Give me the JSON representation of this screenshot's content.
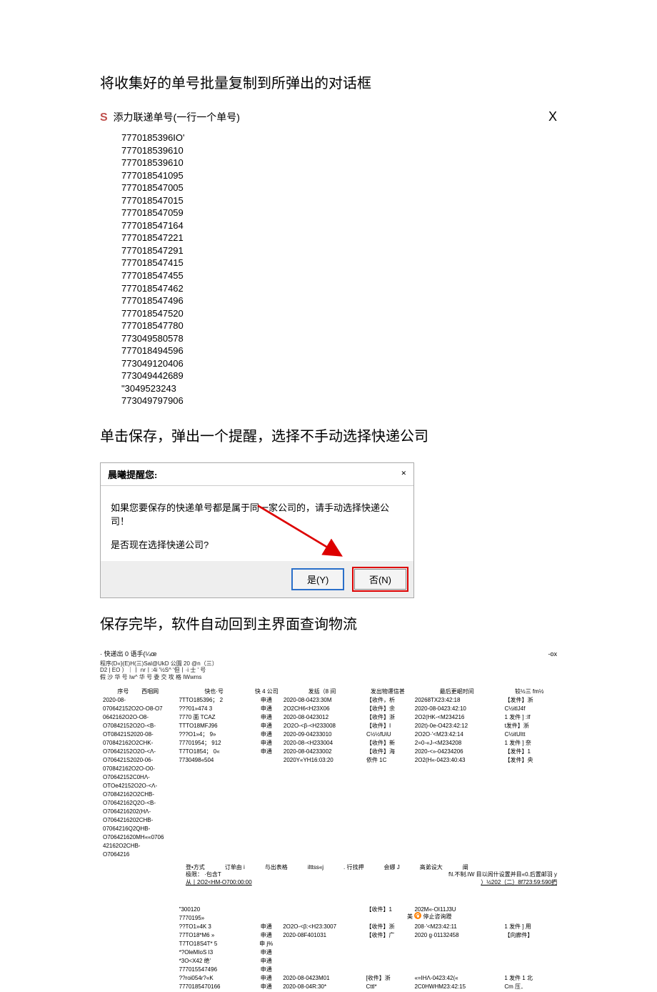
{
  "section1": {
    "heading": "将收集好的单号批量复制到所弹出的对话框",
    "dialog": {
      "icon": "S",
      "title": "添力联递单号(一行一个单号)",
      "close": "X"
    },
    "tracking_numbers": [
      "7770185396IO'",
      "777018539610",
      "777018539610",
      "777018541095",
      "777018547005",
      "777018547015",
      "777018547059",
      "777018547164",
      "777018547221",
      "777018547291",
      "777018547415",
      "777018547455",
      "777018547462",
      "777018547496",
      "777018547520",
      "777018547780",
      "773049580578",
      "777018494596",
      "773049120406",
      "773049442689",
      "\"3049523243",
      "773049797906"
    ]
  },
  "section2": {
    "heading": "单击保存，弹出一个提醒，选择不手动选择快递公司",
    "dialog": {
      "title": "晨曦提醒您:",
      "close": "×",
      "msg1": "如果您要保存的快递单号都是属于同一家公司的，请手动选择快递公司！",
      "msg2": "是否现在选择快递公司?",
      "btn_yes": "是(Y)",
      "btn_no": "否(N)"
    }
  },
  "section3": {
    "heading": "保存完毕，软件自动回到主界面查询物流",
    "window": {
      "title_left": "· 快递出 0 语手(¼œ",
      "title_right": "-ox",
      "menu_line1": "程序(D«}(E)H(三)Sal@UkD 公園 20 @n（三）",
      "menu_line2": "    D2 | EO ）｜丨 nr丨:4i '½S^ '但丨·i 士 ' 号",
      "menu_line3": "假 沙 华 号  Iw^ 华 号 委 交 攻 格  IWwms",
      "headers": {
        "seq": "序号",
        "trail": "西咽网",
        "trk": "快也·号",
        "comp": "快 4 公司",
        "send": "发括（8 间",
        "info": "发出物運信甚",
        "time": "最后更岷时间",
        "last": "较½三 fm½"
      },
      "col_seq": [
        "2020-08-",
        "070642152O2O-O8-O7",
        "0642162O2O-O8-",
        "O70842152O2O-<B-",
        "OT08421S2020-08-",
        "070842162O2CHK-",
        "O70642152O2O-<Λ-",
        "O706421S2020-06-",
        "070842162O2O-O0-",
        "O70642152C0HΛ-",
        "OTOe42152O2O-<Λ-",
        "O70842162O2CHB-",
        "O70642162Q2O-<B-",
        "O7064216202(HΛ-",
        "O7064216202CHB-",
        "07064216Q2QHB-",
        "O706421620MH««0706",
        "42162O2CHB-",
        "O7064216"
      ],
      "col_trk": [
        "7TTO185396；  2",
        "???01»474      3",
        "7770 面 TCAZ",
        "TTTO18MFJ96",
        "???O1»4；   9»",
        "77701954；  912",
        "T7TO1854；  0«",
        "7730498«504"
      ],
      "col_comp_many": "申通",
      "col_send": [
        "2020-08-0423:30M",
        "2O2CH6<H23X06",
        "2020-08-0423012",
        "2O2O-<β-<H233008",
        "2020-09-04233010",
        "2020-08-<H233004",
        "2020-08-04233002",
        "2020Y«YH16:03:20"
      ],
      "col_info": [
        "【收件，析",
        "【收件】余",
        "【收件】浙",
        "【收件】I",
        "C½½fUiU",
        "【收件】新",
        "【收件】海",
        "依件 1C"
      ],
      "col_time": [
        "20268TX23:42:18",
        "2020-08-0423:42:10",
        "2O2(HK-<M234216",
        "202t)-0e-O423:42:12",
        "2O2O·'<M23:42:14",
        "2=0-«J-<M234208",
        "2020-<»-04234206",
        "2O2(H«-0423:40:43"
      ],
      "col_last": [
        "【发件】浙",
        "C½itlJ4f",
        "1 发件 ] :If",
        "t发件】浙",
        "C½itUItt",
        "1 发件 ] 奈",
        "【发件】1",
        "【发件】央"
      ],
      "mid_row_labels": [
        "登•方式",
        "订单由 i",
        "与出表格",
        "ilttss«j",
        ". 行找押",
        "会娜 J",
        "高弟设大",
        "阐"
      ],
      "mid_row_sub1": "f\\l.不制.IW 目以闾什设置并目«0.后置邮羽 y",
      "mid_row_sub2": "）½202（二）8f723:59:590捫",
      "extreme_label": "极限：",
      "extreme_sub": "·包含T",
      "extreme_range": "从丨2O2<HM-O700:00:00",
      "bottom_trk": [
        "\"300120",
        "7770195»",
        "??TO1»4K       3",
        "77TO18*M6      »",
        "T7TO18S4T*    5",
        "*?OleMIoS      I3",
        "*3O<X42 绝'",
        "777015547496",
        "??roi054r?«K",
        "7770185470166"
      ],
      "bottom_comp": [
        "",
        "",
        "申通",
        "申通",
        "申 j%",
        "申通",
        "申通",
        "申通",
        "申通",
        "申通"
      ],
      "bottom_send": [
        "",
        "",
        "2O2O-<β:<H23:3007",
        "2020-08F401031",
        "",
        "",
        "",
        "",
        "2020-08-0423M01",
        "2020-08-04R:30*"
      ],
      "bottom_info": [
        "【收件】1",
        "",
        "【收件】浙",
        "【收件】广",
        "",
        "",
        "",
        "",
        "[收件】浙",
        "Cttl*"
      ],
      "bottom_time": [
        "202M«-OI11J3U",
        "",
        "208·'<M23:42:11",
        "2020 g·01132458",
        "",
        "",
        "",
        "",
        "«=IHΛ-0423:42(«",
        "2C0HWHM23:42:15"
      ],
      "bottom_last": [
        "",
        "",
        "1 发件 ] 用",
        "【向廊件】",
        "",
        "",
        "",
        "",
        "1 发件 1 北",
        "Cm 压．"
      ],
      "stop_label": "停止咨询蹬",
      "stop_prefix": "美"
    }
  }
}
